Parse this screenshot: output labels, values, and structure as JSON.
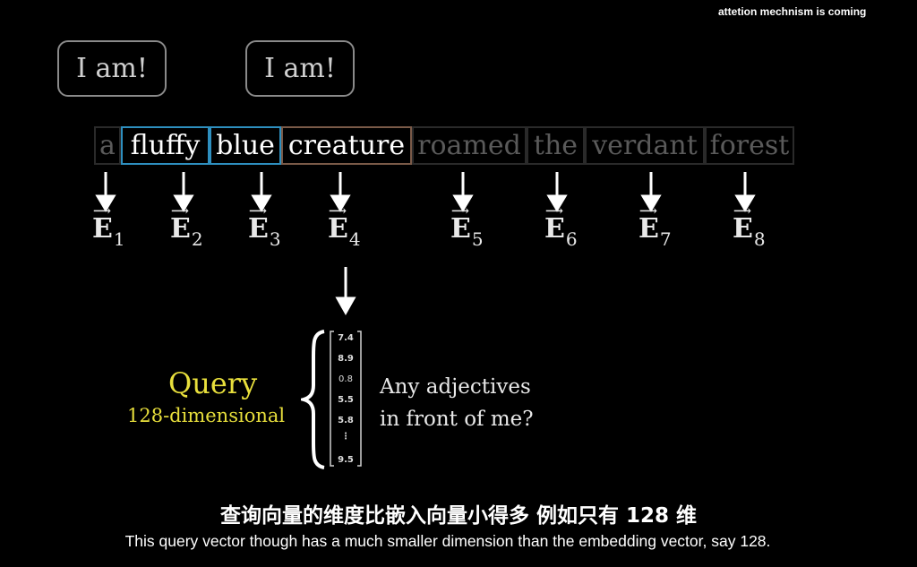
{
  "overlay_title": "attetion mechnism is coming",
  "bubbles": [
    "I am!",
    "I am!"
  ],
  "tokens": [
    "a",
    "fluffy",
    "blue",
    "creature",
    "roamed",
    "the",
    "verdant",
    "forest"
  ],
  "embedding": {
    "symbol": "E",
    "subscripts": [
      "1",
      "2",
      "3",
      "4",
      "5",
      "6",
      "7",
      "8"
    ]
  },
  "query": {
    "label": "Query",
    "dimension": "128-dimensional",
    "values": [
      "7.4",
      "8.9",
      "0.8",
      "5.5",
      "5.8",
      "⋮",
      "9.5"
    ],
    "question_line1": "Any adjectives",
    "question_line2": "in front of me?"
  },
  "subtitles": {
    "zh": "查询向量的维度比嵌入向量小得多  例如只有 128 维",
    "en": "This query vector though has a much smaller dimension than the embedding vector, say 128."
  },
  "colors": {
    "background": "#000000",
    "highlight_border": "#2e8fbf",
    "creature_border": "#7a5a48",
    "query_yellow": "#e8df3c",
    "dim_text": "#5a5a5a"
  }
}
